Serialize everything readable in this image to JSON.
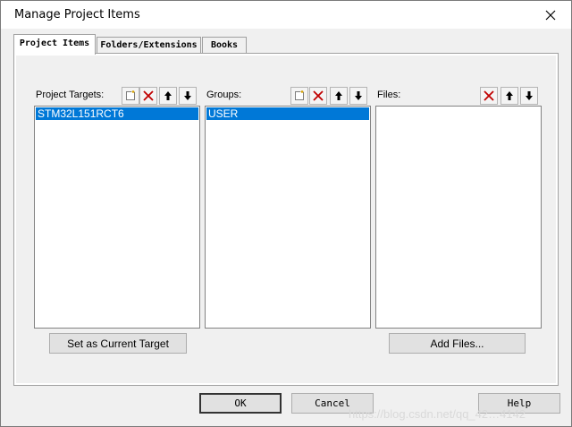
{
  "window": {
    "title": "Manage Project Items"
  },
  "tabs": [
    {
      "label": "Project Items",
      "active": true
    },
    {
      "label": "Folders/Extensions",
      "active": false
    },
    {
      "label": "Books",
      "active": false
    }
  ],
  "project_targets": {
    "label": "Project Targets:",
    "items": [
      "STM32L151RCT6"
    ],
    "selected": "STM32L151RCT6"
  },
  "groups": {
    "label": "Groups:",
    "items": [
      "USER"
    ],
    "selected": "USER"
  },
  "files": {
    "label": "Files:",
    "items": []
  },
  "buttons": {
    "set_current_target": "Set as Current Target",
    "add_files": "Add Files...",
    "ok": "OK",
    "cancel": "Cancel",
    "help": "Help"
  },
  "watermark": "https://blog.csdn.net/qq_42…4142",
  "icons": {
    "new": "new-item-icon",
    "delete": "delete-icon",
    "move_up": "arrow-up-icon",
    "move_down": "arrow-down-icon",
    "close": "close-icon"
  },
  "colors": {
    "selection": "#0078d7",
    "delete_red": "#c00000"
  }
}
